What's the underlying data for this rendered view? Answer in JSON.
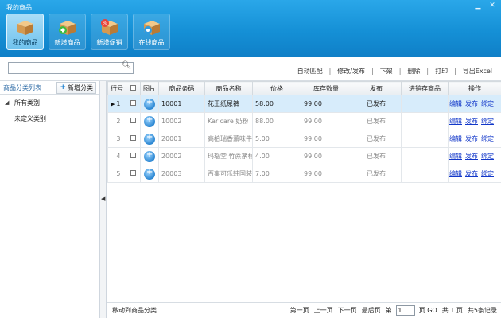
{
  "app": {
    "title": "我的商品"
  },
  "toolbar": [
    {
      "label": "我的商品",
      "icon": "box-icon",
      "active": true
    },
    {
      "label": "新增商品",
      "icon": "box-add-icon",
      "active": false
    },
    {
      "label": "新增促销",
      "icon": "box-promo-icon",
      "active": false
    },
    {
      "label": "在线商品",
      "icon": "box-online-icon",
      "active": false
    }
  ],
  "search": {
    "value": "",
    "placeholder": ""
  },
  "actions": {
    "auto_match": "自动匹配",
    "edit_publish": "修改/发布",
    "unlist": "下架",
    "delete": "删除",
    "print": "打印",
    "export": "导出Excel"
  },
  "sidebar": {
    "title": "商品分类列表",
    "add_label": "新增分类",
    "items": [
      {
        "label": "所有类别"
      },
      {
        "label": "未定义类别"
      }
    ]
  },
  "grid": {
    "headers": [
      "行号",
      "",
      "图片",
      "商品条码",
      "商品名称",
      "价格",
      "库存数量",
      "发布",
      "进销存商品",
      "操作"
    ],
    "op_links": [
      "编辑",
      "发布",
      "绑定"
    ],
    "rows": [
      {
        "no": "1",
        "barcode": "10001",
        "name": "花王纸尿裤",
        "price": "58.00",
        "stock": "99.00",
        "status": "已发布",
        "erp": "",
        "selected": true
      },
      {
        "no": "2",
        "barcode": "10002",
        "name": "Karicare 奶粉",
        "price": "88.00",
        "stock": "99.00",
        "status": "已发布",
        "erp": "",
        "selected": false
      },
      {
        "no": "3",
        "barcode": "20001",
        "name": "高柏瑞香薰味牛奶",
        "price": "5.00",
        "stock": "99.00",
        "status": "已发布",
        "erp": "",
        "selected": false
      },
      {
        "no": "4",
        "barcode": "20002",
        "name": "玛瑙堂 竹蔗茅根",
        "price": "4.00",
        "stock": "99.00",
        "status": "已发布",
        "erp": "",
        "selected": false
      },
      {
        "no": "5",
        "barcode": "20003",
        "name": "百事可乐韩国装",
        "price": "7.00",
        "stock": "99.00",
        "status": "已发布",
        "erp": "",
        "selected": false
      }
    ]
  },
  "footer": {
    "move_category": "移动到商品分类...",
    "first": "第一页",
    "prev": "上一页",
    "next": "下一页",
    "last": "最后页",
    "page_prefix": "第",
    "page_value": "1",
    "go": "页 GO",
    "total_pages": "共 1 页",
    "total_records": "共5条记录"
  }
}
